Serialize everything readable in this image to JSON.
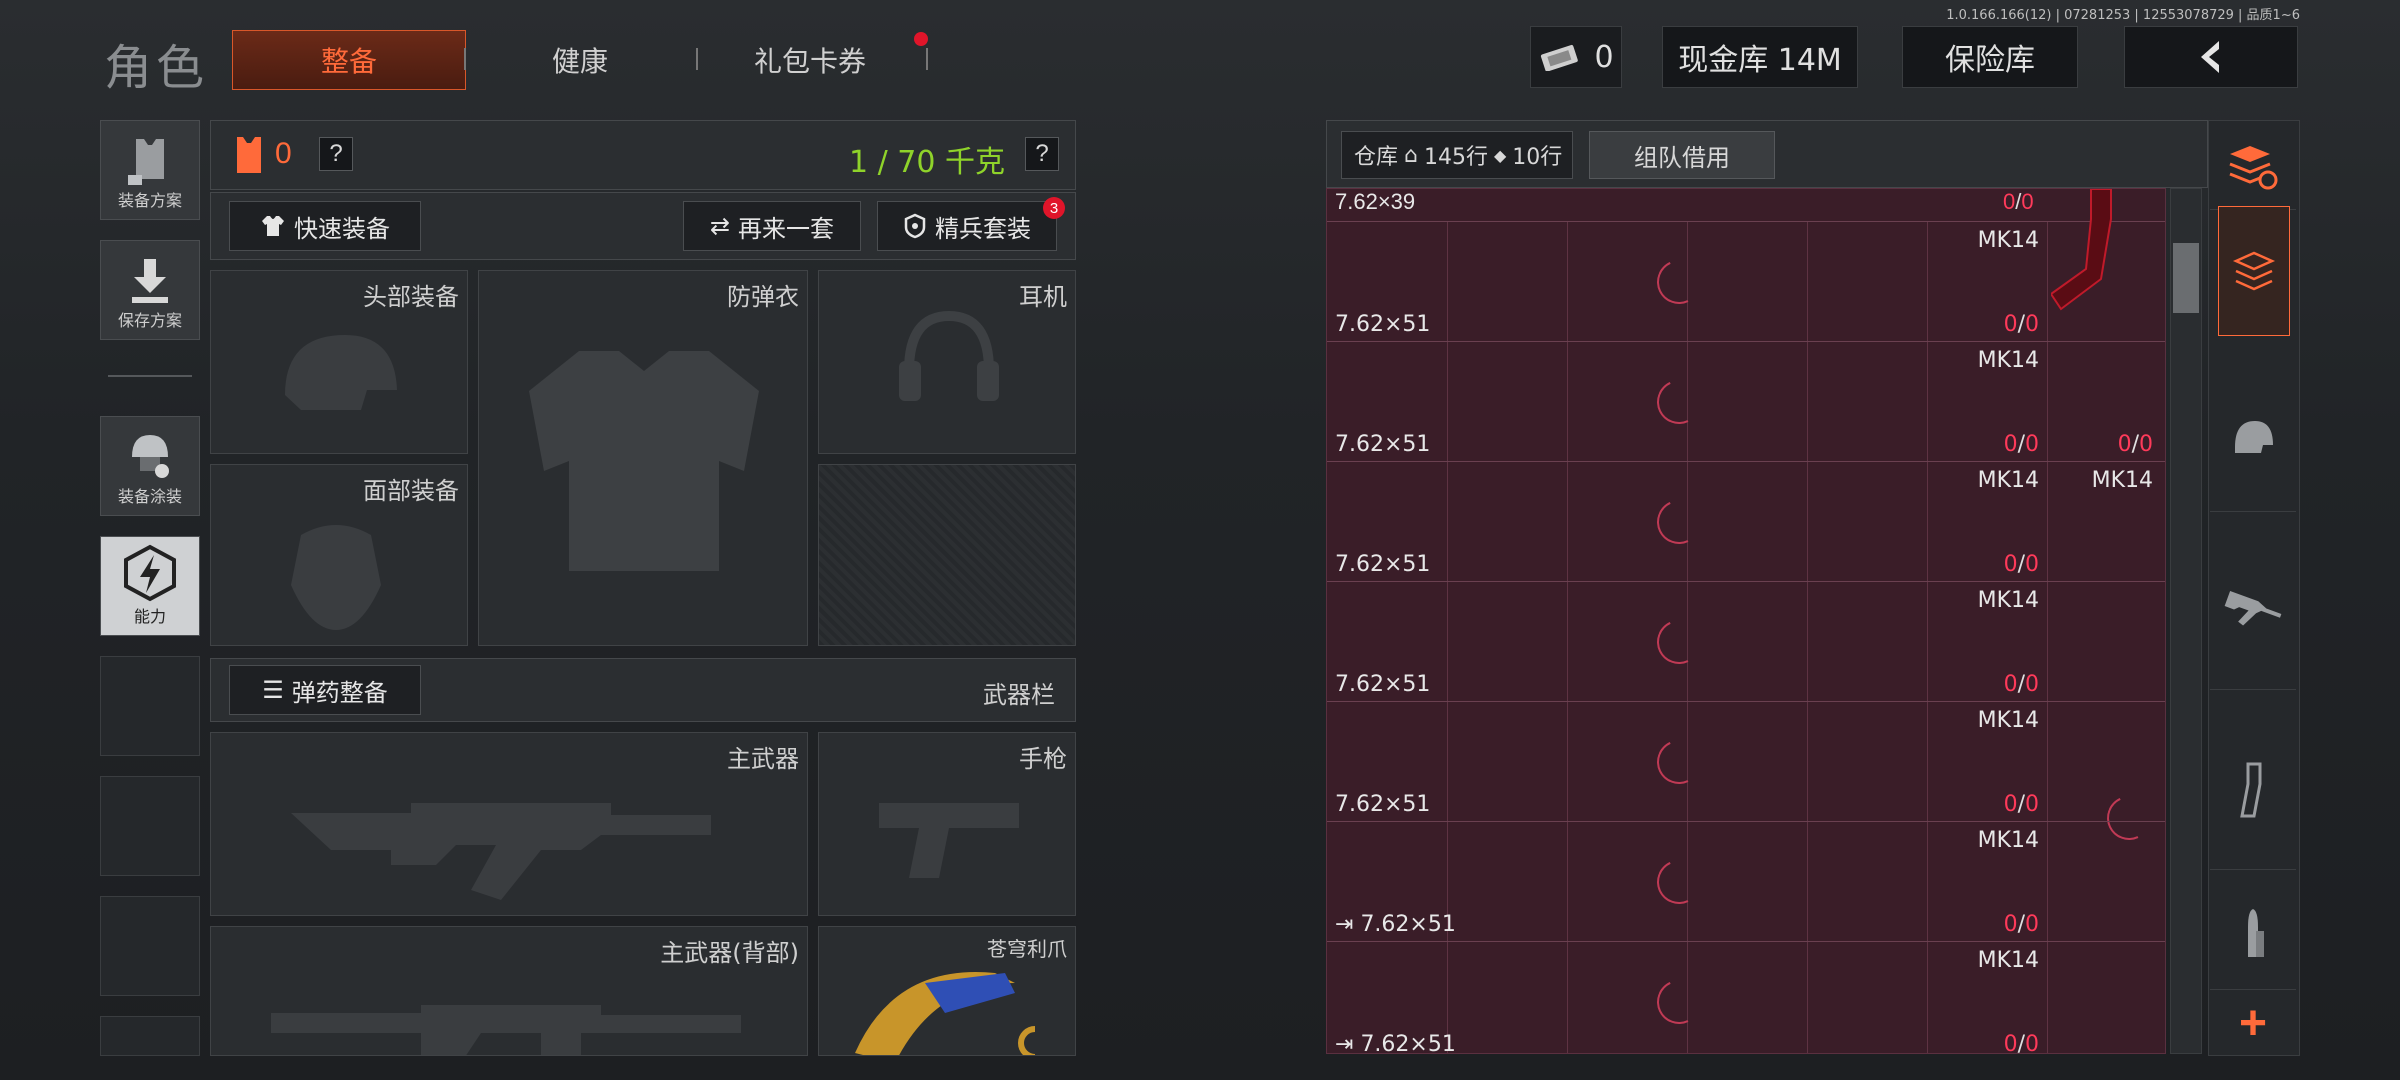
{
  "version": "1.0.166.166(12) | 07281253 | 12553078729 | 品质1~6",
  "header": {
    "title": "角色",
    "tabs": [
      {
        "label": "整备",
        "active": true
      },
      {
        "label": "健康"
      },
      {
        "label": "礼包卡券",
        "badge": true
      }
    ],
    "ticket_count": "0",
    "cash": "现金库 14M",
    "safe": "保险库"
  },
  "sidebar": {
    "items": [
      {
        "label": "装备方案"
      },
      {
        "label": "保存方案"
      },
      {
        "label": "装备涂装"
      },
      {
        "label": "能力"
      }
    ]
  },
  "loadout": {
    "armor_value": "0",
    "help": "?",
    "weight": "1 / 70 千克",
    "quick_equip": "快速装备",
    "again": "再来一套",
    "elite": "精兵套装",
    "elite_badge": "3",
    "slots": {
      "head": "头部装备",
      "armor": "防弹衣",
      "earphone": "耳机",
      "face": "面部装备"
    },
    "ammo_equip": "弹药整备",
    "weapon_bar": "武器栏",
    "primary": "主武器",
    "pistol": "手枪",
    "primary_back": "主武器(背部)",
    "melee": "苍穹利爪"
  },
  "inventory": {
    "label": "仓库",
    "rows_label": "145行",
    "rows2_label": "10行",
    "team_borrow": "组队借用",
    "top_row": {
      "caliber": "7.62×39",
      "count_a": "0",
      "count_b": "0"
    },
    "rows": [
      {
        "caliber": "7.62×51",
        "mk": "MK14",
        "a": "0",
        "b": "0",
        "extra_a": "",
        "extra_b": "",
        "extra_mk": "",
        "icon": false
      },
      {
        "caliber": "7.62×51",
        "mk": "MK14",
        "a": "0",
        "b": "0",
        "extra_a": "0",
        "extra_b": "0",
        "extra_mk": "",
        "icon": false
      },
      {
        "caliber": "7.62×51",
        "mk": "MK14",
        "a": "0",
        "b": "0",
        "extra_a": "",
        "extra_b": "",
        "extra_mk": "MK14",
        "icon": false
      },
      {
        "caliber": "7.62×51",
        "mk": "MK14",
        "a": "0",
        "b": "0",
        "extra_a": "",
        "extra_b": "",
        "extra_mk": "",
        "icon": false
      },
      {
        "caliber": "7.62×51",
        "mk": "MK14",
        "a": "0",
        "b": "0",
        "extra_a": "",
        "extra_b": "",
        "extra_mk": "",
        "icon": false
      },
      {
        "caliber": "7.62×51",
        "mk": "MK14",
        "a": "0",
        "b": "0",
        "extra_a": "",
        "extra_b": "",
        "extra_mk": "",
        "icon": true
      },
      {
        "caliber": "7.62×51",
        "mk": "MK14",
        "a": "0",
        "b": "0",
        "extra_a": "",
        "extra_b": "",
        "extra_mk": "",
        "icon": true
      }
    ]
  },
  "right_bar": {
    "add": "+"
  },
  "colors": {
    "accent": "#ff6a3a",
    "count_red": "#ff3a5a",
    "weight_green": "#8fd32a"
  }
}
